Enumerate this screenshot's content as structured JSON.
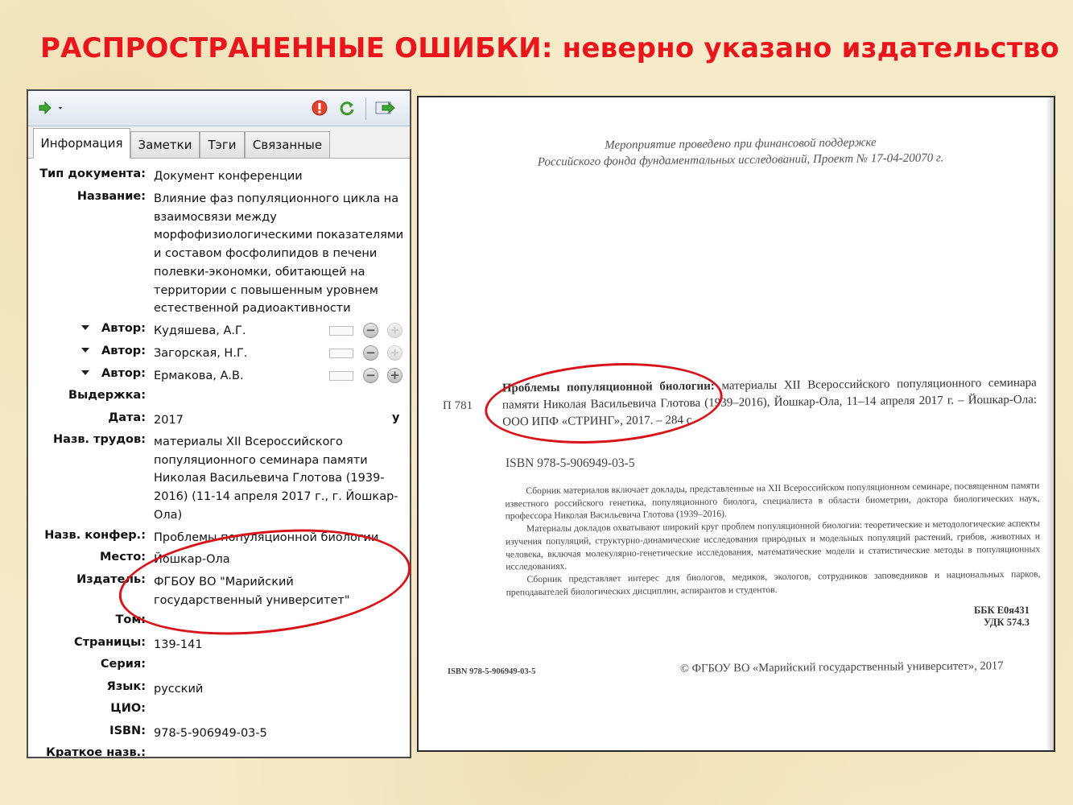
{
  "slide": {
    "title": "РАСПРОСТРАНЕННЫЕ ОШИБКИ: неверно указано издательство"
  },
  "panel": {
    "toolbar": {
      "icons": [
        "green-arrow-icon",
        "dropdown-caret-icon",
        "error-icon",
        "sync-icon",
        "export-icon"
      ]
    },
    "tabs": [
      {
        "label": "Информация"
      },
      {
        "label": "Заметки"
      },
      {
        "label": "Тэги"
      },
      {
        "label": "Связанные"
      }
    ],
    "fields": {
      "doc_type": {
        "label": "Тип документа:",
        "value": "Документ конференции"
      },
      "title": {
        "label": "Название:",
        "value": "Влияние фаз популяционного цикла на взаимосвязи между морфофизиологическими показателями и составом фосфолипидов в печени полевки-экономки, обитающей на территории с повышенным уровнем естественной радиоактивности"
      },
      "authors": [
        {
          "label": "Автор:",
          "value": "Кудяшева, А.Г."
        },
        {
          "label": "Автор:",
          "value": "Загорская, Н.Г."
        },
        {
          "label": "Автор:",
          "value": "Ермакова, А.В."
        }
      ],
      "abstract": {
        "label": "Выдержка:",
        "value": ""
      },
      "date": {
        "label": "Дата:",
        "value": "2017",
        "suffix": "y"
      },
      "proceedings": {
        "label": "Назв. трудов:",
        "value": "материалы XII Всероссийского популяционного семинара памяти Николая Васильевича Глотова (1939-2016) (11-14 апреля 2017 г., г. Йошкар-Ола)"
      },
      "conference": {
        "label": "Назв. конфер.:",
        "value": "Проблемы популяционной биологии"
      },
      "place": {
        "label": "Место:",
        "value": "Йошкар-Ола"
      },
      "publisher": {
        "label": "Издатель:",
        "value": "ФГБОУ ВО \"Марийский государственный университет\""
      },
      "volume": {
        "label": "Том:",
        "value": ""
      },
      "pages": {
        "label": "Страницы:",
        "value": "139-141"
      },
      "series": {
        "label": "Серия:",
        "value": ""
      },
      "language": {
        "label": "Язык:",
        "value": "русский"
      },
      "doi": {
        "label": "ЦИО:",
        "value": ""
      },
      "isbn": {
        "label": "ISBN:",
        "value": "978-5-906949-03-5"
      },
      "short_title": {
        "label": "Краткое назв.:",
        "value": ""
      }
    }
  },
  "document": {
    "support_line1": "Мероприятие проведено при финансовой поддержке",
    "support_line2": "Российского фонда фундаментальных исследований, Проект № 17-04-20070 г.",
    "catalog_code": "П 781",
    "biblio_title": "Проблемы популяционной биологии:",
    "biblio_rest": " материалы XII Всероссийского популяционного семинара памяти Николая Васильевича Глотова (1939–2016), Йошкар-Ола, 11–14 апреля 2017 г. – Йошкар-Ола: ООО ИПФ «СТРИНГ», 2017. – 284 с.",
    "isbn": "ISBN 978-5-906949-03-5",
    "abstract_p1": "Сборник материалов включает доклады, представленные на XII Всероссийском популяционном семинаре, посвященном памяти известного российского генетика, популяционного биолога, специалиста в области биометрии, доктора биологических наук, профессора Николая Васильевича Глотова (1939–2016).",
    "abstract_p2": "Материалы докладов охватывают широкий круг проблем популяционной биологии: теоретические и методологические аспекты изучения популяций, структурно-динамические исследования природных и модельных популяций растений, грибов, животных и человека, включая молекулярно-генетические исследования, математические модели и статистические методы в популяционных исследованиях.",
    "abstract_p3": "Сборник представляет интерес для биологов, медиков, экологов, сотрудников заповедников и национальных парков, преподавателей биологических дисциплин, аспирантов и студентов.",
    "bbk": "ББК Е0я431",
    "udk": "УДК 574.3",
    "isbn_small": "ISBN 978-5-906949-03-5",
    "copyright": "© ФГБОУ ВО «Марийский государственный университет», 2017"
  },
  "colors": {
    "title_red": "#e8151c",
    "annotation_red": "#d8141b",
    "slide_background": "#f6ebc8"
  }
}
